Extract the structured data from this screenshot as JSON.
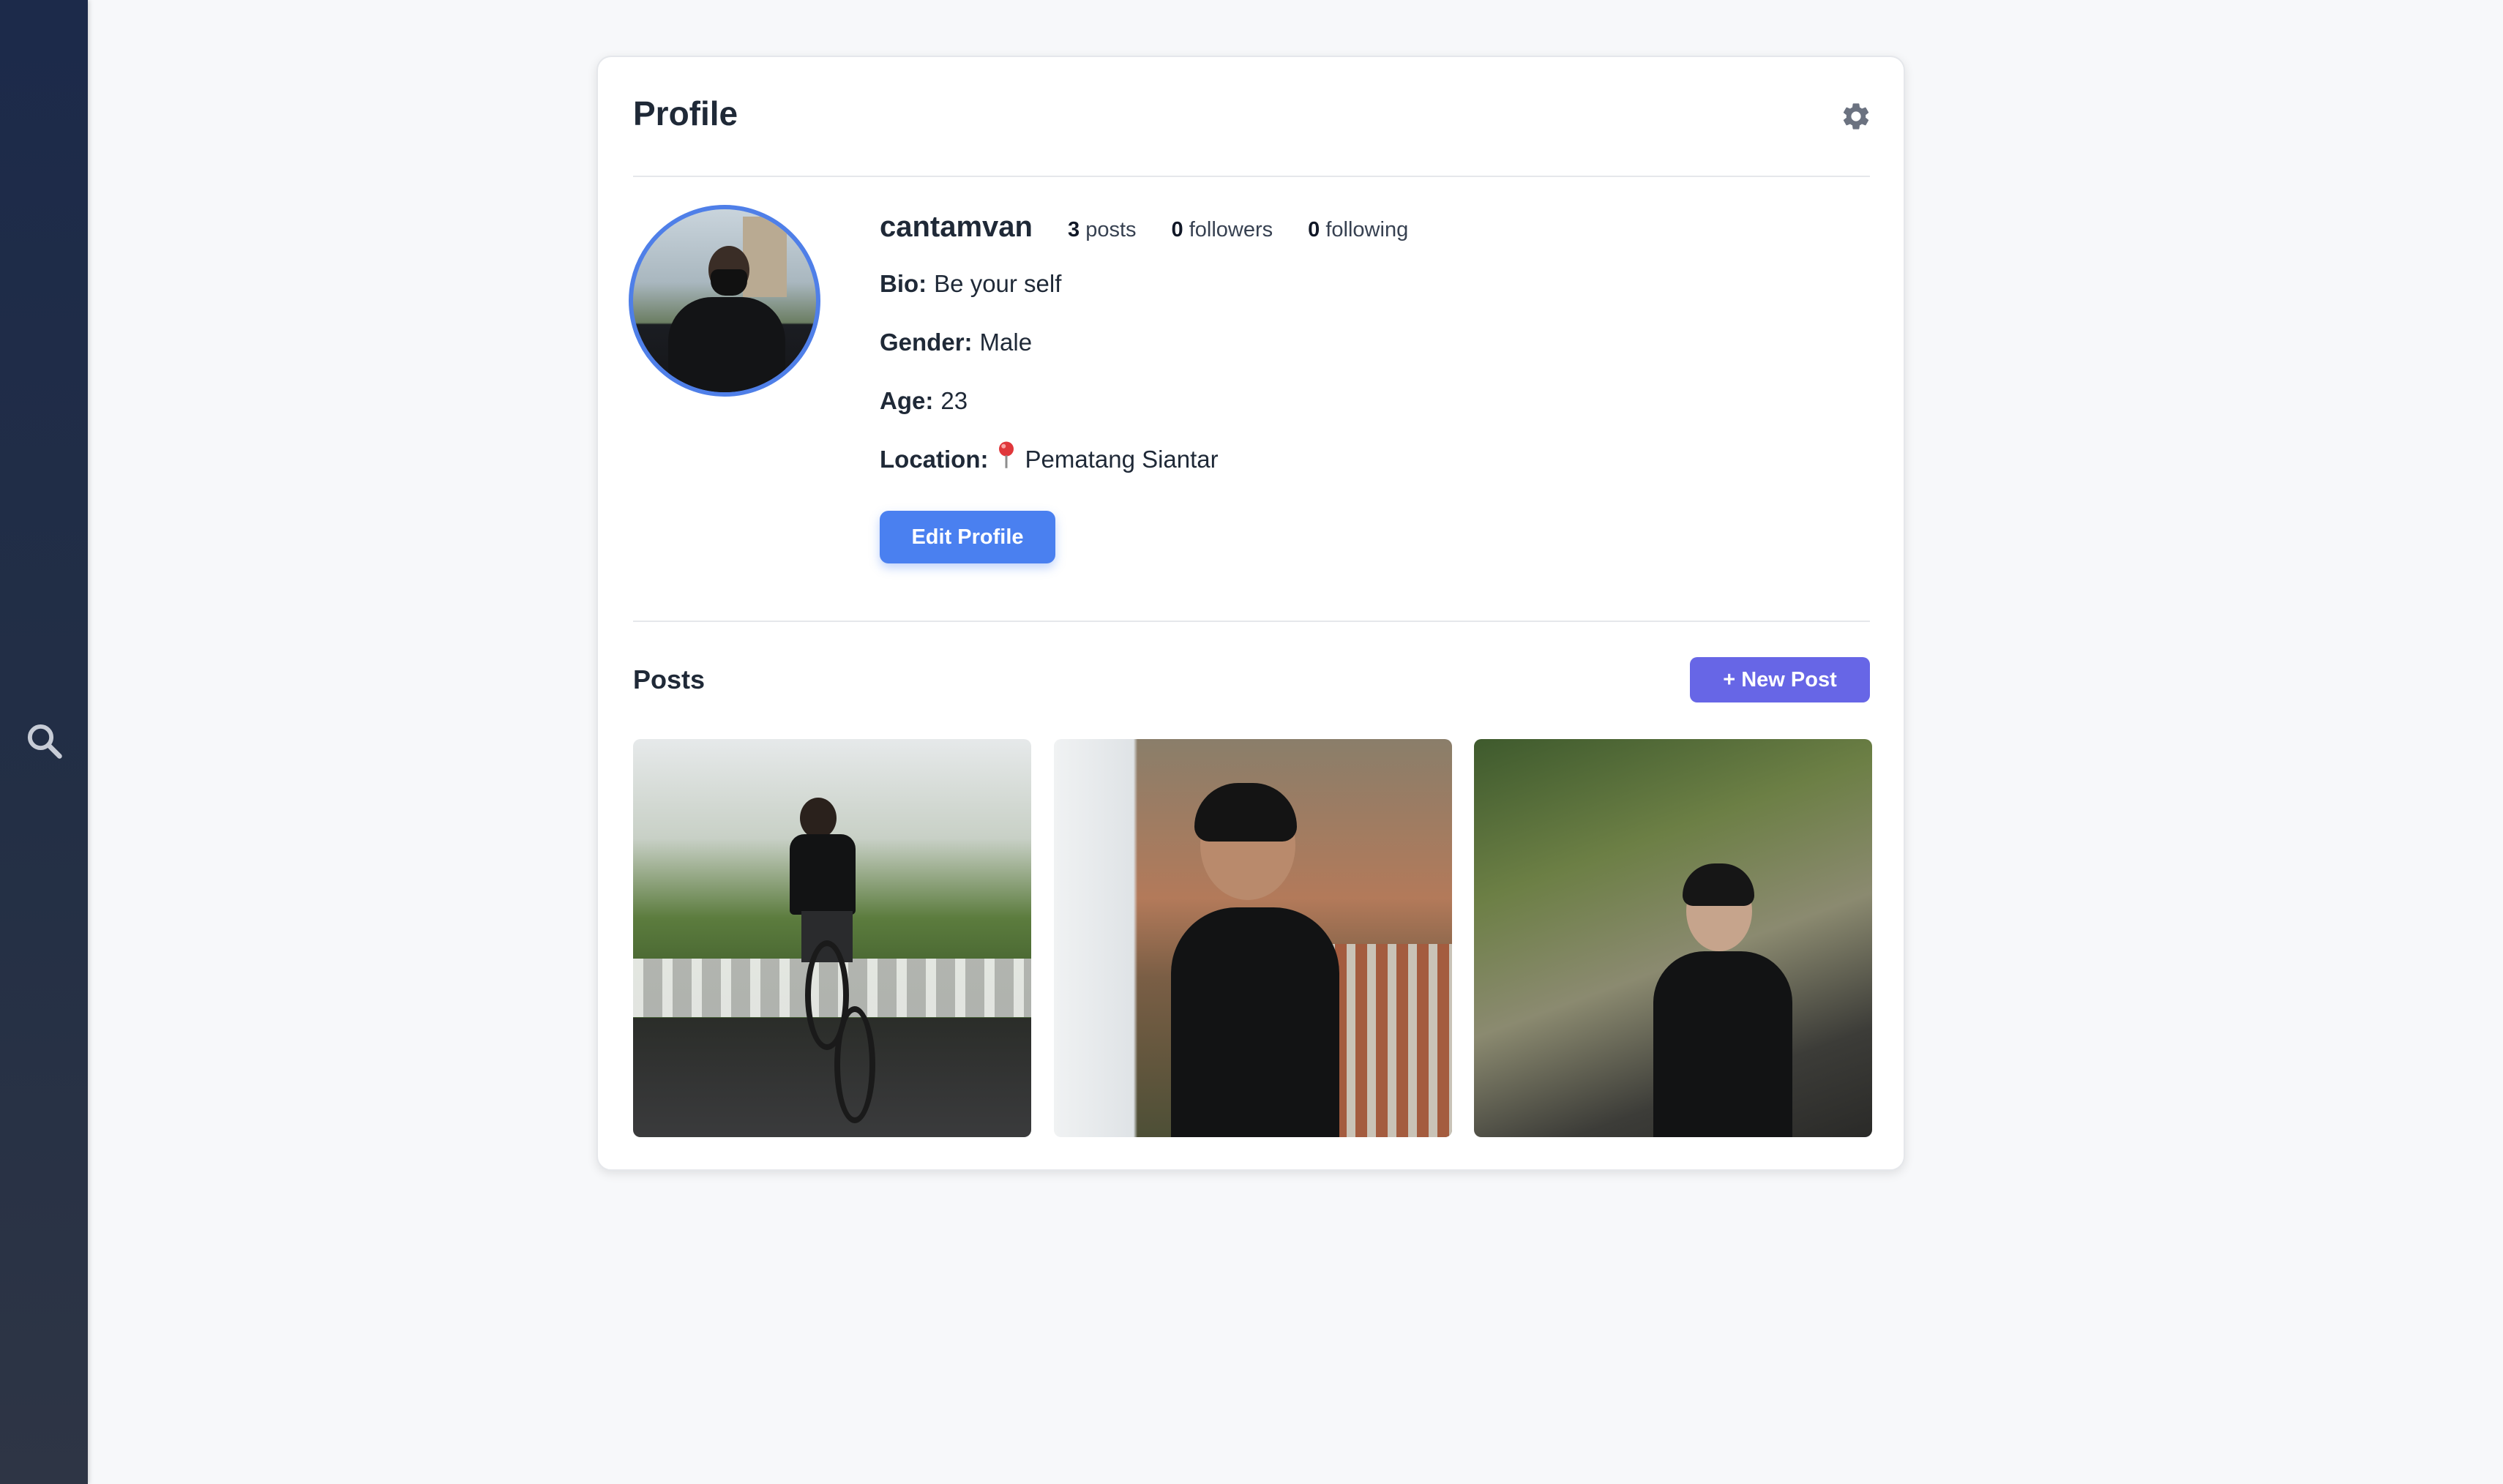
{
  "sidebar": {
    "search_icon": "search-icon"
  },
  "profile": {
    "title": "Profile",
    "settings_icon": "gear-icon",
    "username": "cantamvan",
    "stats": {
      "posts_count": "3",
      "posts_label": "posts",
      "followers_count": "0",
      "followers_label": "followers",
      "following_count": "0",
      "following_label": "following"
    },
    "bio_label": "Bio:",
    "bio_value": "Be your self",
    "gender_label": "Gender:",
    "gender_value": "Male",
    "age_label": "Age:",
    "age_value": "23",
    "location_label": "Location:",
    "location_icon": "map-pin-icon",
    "location_value": "Pematang Siantar",
    "edit_button": "Edit Profile"
  },
  "posts": {
    "title": "Posts",
    "new_post_button": "+ New Post",
    "items": [
      {
        "description_icon": "photo-bike-wheelie"
      },
      {
        "description_icon": "photo-portrait-side"
      },
      {
        "description_icon": "photo-portrait-garden"
      }
    ]
  },
  "colors": {
    "accent_blue": "#4a80f0",
    "accent_indigo": "#6766e6",
    "avatar_ring": "#4f7fe8",
    "sidebar": "#1c2a4a"
  }
}
